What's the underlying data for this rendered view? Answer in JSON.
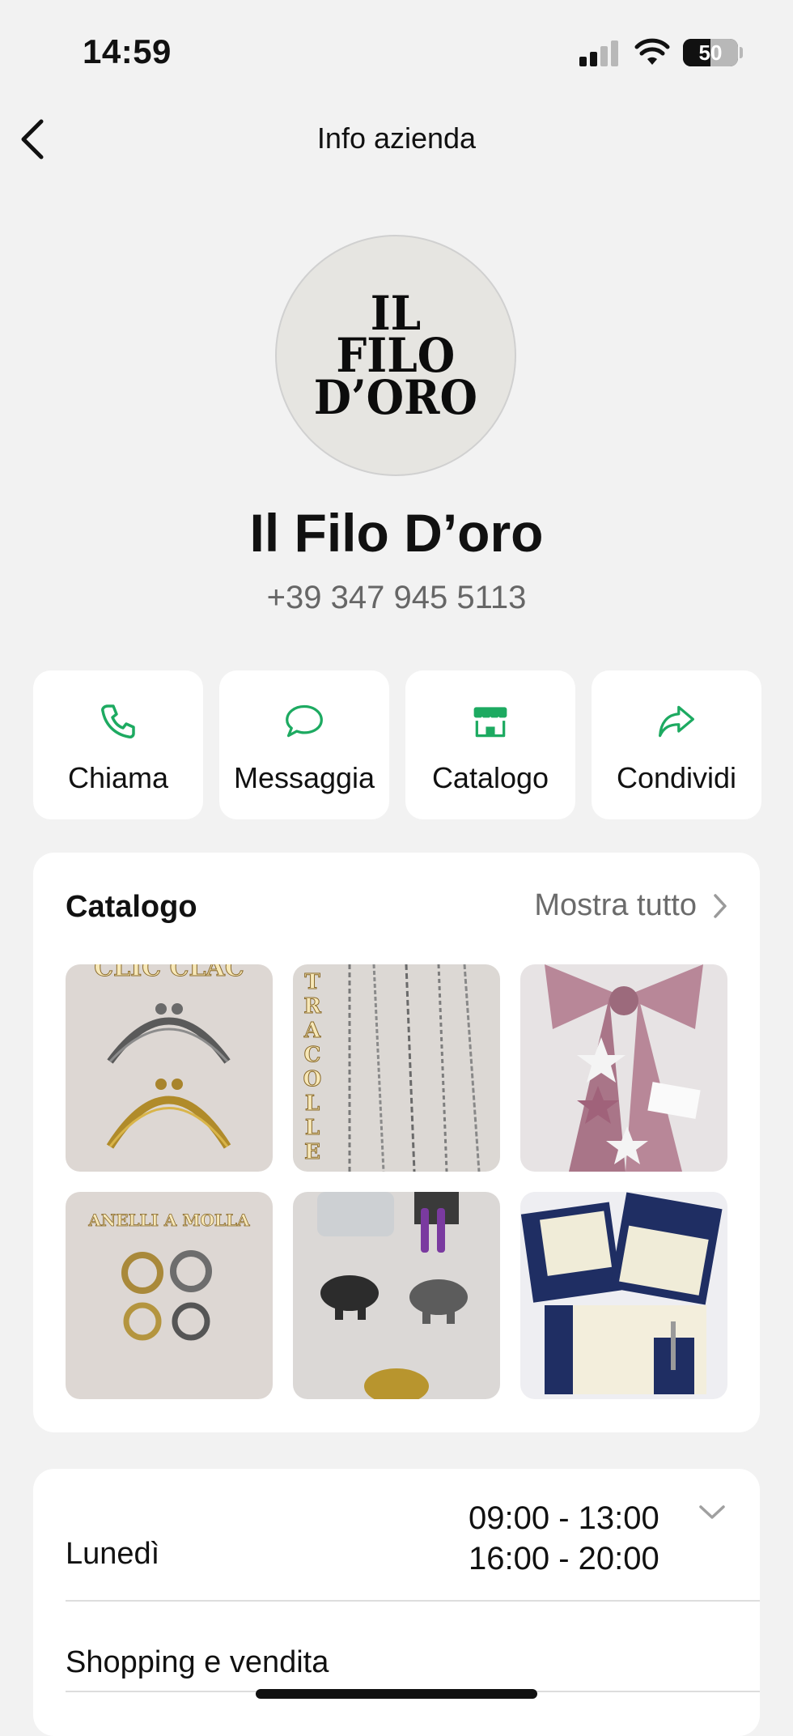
{
  "status_bar": {
    "time": "14:59",
    "battery_level": "50"
  },
  "nav": {
    "title": "Info azienda"
  },
  "profile": {
    "logo_lines": [
      "IL",
      "FILO",
      "D’ORO"
    ],
    "name": "Il Filo D’oro",
    "phone": "+39 347 945 5113"
  },
  "actions": [
    {
      "label": "Chiama",
      "icon": "phone-icon"
    },
    {
      "label": "Messaggia",
      "icon": "chat-bubble-icon"
    },
    {
      "label": "Catalogo",
      "icon": "store-icon"
    },
    {
      "label": "Condividi",
      "icon": "share-arrow-icon"
    }
  ],
  "catalog": {
    "title": "Catalogo",
    "show_all": "Mostra tutto",
    "items": [
      {
        "overlay_text": "CLIC CLAC"
      },
      {
        "overlay_text": "TRACOLLE"
      },
      {
        "overlay_text": ""
      },
      {
        "overlay_text": "ANELLI A MOLLA"
      },
      {
        "overlay_text": ""
      },
      {
        "overlay_text": ""
      }
    ]
  },
  "hours": {
    "day": "Lunedì",
    "slots": [
      "09:00 - 13:00",
      "16:00 - 20:00"
    ]
  },
  "category": "Shopping e vendita",
  "colors": {
    "accent": "#1daa61",
    "background": "#f2f2f2",
    "card": "#ffffff"
  }
}
